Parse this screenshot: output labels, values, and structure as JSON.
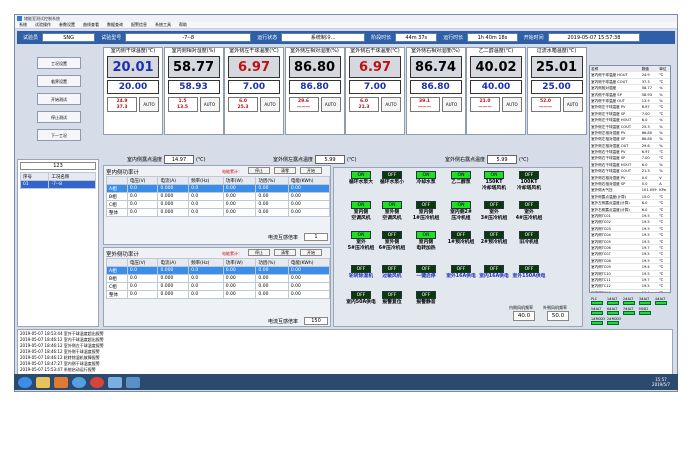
{
  "title": "储能室测试控制系统",
  "menu": [
    "系统",
    "试验操作",
    "参数设置",
    "曲线查看",
    "数据查询",
    "报警信息",
    "系统工具",
    "帮助"
  ],
  "info": [
    {
      "label": "试验员",
      "value": "SNG"
    },
    {
      "label": "试验型号",
      "value": "-7--8"
    },
    {
      "label": "运行状态",
      "value": "系统制冷..."
    },
    {
      "label": "阶段时长",
      "value": "44m 37s"
    },
    {
      "label": "运行时长",
      "value": "1h 40m 18s"
    },
    {
      "label": "开始时间",
      "value": "2019-05-07 15:57:38"
    }
  ],
  "left_buttons": [
    "工况设置",
    "临界设置",
    "开始测试",
    "停止测试",
    "下一工况"
  ],
  "tiles": [
    {
      "header": "室内侧干球温度(℃)",
      "pv": "20.01",
      "pv_color": "#1c2fb4",
      "sv": "20.00",
      "mv": "24.9\n37.3",
      "mode": "AUTO"
    },
    {
      "header": "室内侧相对湿度(%)",
      "pv": "58.77",
      "pv_color": "#000000",
      "sv": "58.93",
      "mv": "1.5\n13.5",
      "mode": "AUTO"
    },
    {
      "header": "室外侧左干球温度(℃)",
      "pv": "6.97",
      "pv_color": "#c01010",
      "sv": "7.00",
      "mv": "6.0\n25.3",
      "mode": "AUTO"
    },
    {
      "header": "室外侧左相对湿度(%)",
      "pv": "86.80",
      "pv_color": "#000000",
      "sv": "86.80",
      "mv": "29.6\n———",
      "mode": "AUTO"
    },
    {
      "header": "室外侧右干球温度(℃)",
      "pv": "6.97",
      "pv_color": "#c01010",
      "sv": "7.00",
      "mv": "6.0\n21.3",
      "mode": "AUTO"
    },
    {
      "header": "室外侧右相对湿度(%)",
      "pv": "86.74",
      "pv_color": "#000000",
      "sv": "86.80",
      "mv": "39.1\n———",
      "mode": "AUTO"
    },
    {
      "header": "乙二醇温度(℃)",
      "pv": "40.02",
      "pv_color": "#000000",
      "sv": "40.00",
      "mv": "21.0\n———",
      "mode": "AUTO"
    },
    {
      "header": "过流水箱温度(℃)",
      "pv": "25.01",
      "pv_color": "#000000",
      "sv": "25.00",
      "mv": "52.0\n———",
      "mode": "AUTO"
    }
  ],
  "dew": [
    {
      "label": "室内侧露点温度",
      "value": "14.97",
      "unit": "(℃)"
    },
    {
      "label": "室外侧左露点温度",
      "value": "5.99",
      "unit": "(℃)"
    },
    {
      "label": "室外侧右露点温度",
      "value": "5.99",
      "unit": "(℃)"
    }
  ],
  "left_list": {
    "value": "123",
    "headers": [
      "序号",
      "工况名称"
    ],
    "rows": [
      [
        "01",
        "-7--8"
      ]
    ]
  },
  "power": [
    {
      "title": "室内侧功率计",
      "hint": "电能累计：",
      "btns": [
        "停止",
        "清零",
        "开始"
      ],
      "headers": [
        "",
        "电压(V)",
        "电流(A)",
        "频率(Hz)",
        "功率(W)",
        "功因(%)",
        "电能(KWh)"
      ],
      "rows": [
        [
          "A相",
          "0.0",
          "0.000",
          "0.0",
          "0.00",
          "0.00",
          "0.00"
        ],
        [
          "B相",
          "0.0",
          "0.000",
          "0.0",
          "0.00",
          "0.00",
          "0.00"
        ],
        [
          "C相",
          "0.0",
          "0.000",
          "0.0",
          "0.00",
          "0.00",
          "0.00"
        ],
        [
          "整体",
          "0.0",
          "0.000",
          "0.0",
          "0.00",
          "0.00",
          "0.00"
        ]
      ],
      "ratio_label": "电流互感倍率",
      "ratio": "1"
    },
    {
      "title": "室外侧功率计",
      "hint": "电能累计：",
      "btns": [
        "停止",
        "清零",
        "开始"
      ],
      "headers": [
        "",
        "电压(V)",
        "电流(A)",
        "频率(Hz)",
        "功率(W)",
        "功因(%)",
        "电能(KWh)"
      ],
      "rows": [
        [
          "A相",
          "0.0",
          "0.000",
          "0.0",
          "0.00",
          "0.00",
          "0.00"
        ],
        [
          "B相",
          "0.0",
          "0.000",
          "0.0",
          "0.00",
          "0.00",
          "0.00"
        ],
        [
          "C相",
          "0.0",
          "0.000",
          "0.0",
          "0.00",
          "0.00",
          "0.00"
        ],
        [
          "整体",
          "0.0",
          "0.000",
          "0.0",
          "0.00",
          "0.00",
          "0.00"
        ]
      ],
      "ratio_label": "电流互感倍率",
      "ratio": "150"
    }
  ],
  "switches": [
    [
      {
        "s": "ON",
        "l": "循环水泵大"
      },
      {
        "s": "OFF",
        "l": "循环水泵小"
      },
      {
        "s": "ON",
        "l": "冷却水泵"
      },
      {
        "s": "ON",
        "l": "乙二醇泵"
      },
      {
        "s": "ON",
        "l": "150KT\n冷却塔风机"
      },
      {
        "s": "OFF",
        "l": "100KT\n冷却塔风机"
      }
    ],
    [
      {
        "s": "ON",
        "l": "室内侧\n空调风机"
      },
      {
        "s": "ON",
        "l": "室外侧\n空调风机"
      },
      {
        "s": "OFF",
        "l": "室内侧\n1#压冷机组"
      },
      {
        "s": "ON",
        "l": "室内侧2#\n压冷机组"
      },
      {
        "s": "OFF",
        "l": "室外\n3#压冷机组"
      },
      {
        "s": "OFF",
        "l": "室外\n4#压冷机组"
      }
    ],
    [
      {
        "s": "ON",
        "l": "室外\n5#压冷机组"
      },
      {
        "s": "OFF",
        "l": "室外侧\n6#压冷机组"
      },
      {
        "s": "ON",
        "l": "室内侧\n电转加热"
      },
      {
        "s": "OFF",
        "l": "1#预冷机组"
      },
      {
        "s": "OFF",
        "l": "2#预冷机组"
      },
      {
        "s": "OFF",
        "l": "旧冷机组"
      }
    ],
    [
      {
        "s": "OFF",
        "l": "轮转除湿机"
      },
      {
        "s": "OFF",
        "l": "过敏风机"
      },
      {
        "s": "OFF",
        "l": "一键启停"
      },
      {
        "s": "OFF",
        "l": "室外16A供电"
      },
      {
        "s": "OFF",
        "l": "室内16A供电"
      },
      {
        "s": "OFF",
        "l": "室外150A供电"
      }
    ],
    [
      {
        "s": "OFF",
        "l": "室内50A供电"
      },
      {
        "s": "OFF",
        "l": "报警复位"
      },
      {
        "s": "OFF",
        "l": "报警静音"
      }
    ]
  ],
  "outside": [
    {
      "label": "内侧风机频率",
      "value": "40.0"
    },
    {
      "label": "外侧风机频率",
      "value": "50.0"
    }
  ],
  "rlist": {
    "headers": [
      "名称",
      "数值",
      "单位"
    ],
    "rows": [
      [
        "室内侧干球温度 HOUT",
        "24.9",
        "℃"
      ],
      [
        "室内侧干球温度 COUT",
        "37.3",
        "℃"
      ],
      [
        "室内侧相对湿度",
        "58.77",
        "%"
      ],
      [
        "室内侧干球温度 SP",
        "58.93",
        "%"
      ],
      [
        "室内侧干球温度 OUT",
        "13.5",
        "%"
      ],
      [
        "室外侧左干球温度 PV",
        "6.97",
        "℃"
      ],
      [
        "室外侧左干球温度 SP",
        "7.00",
        "℃"
      ],
      [
        "室外侧左干球温度 HOUT",
        "6.0",
        "%"
      ],
      [
        "室外侧左干球温度 COUT",
        "25.3",
        "%"
      ],
      [
        "室外侧左相对湿度 PV",
        "86.80",
        "%"
      ],
      [
        "室外侧左相对湿度 SP",
        "86.80",
        "%"
      ],
      [
        "室外侧左相对湿度 OUT",
        "29.6",
        "%"
      ],
      [
        "室外侧右干球温度 PV",
        "6.97",
        "℃"
      ],
      [
        "室外侧右干球温度 SP",
        "7.00",
        "℃"
      ],
      [
        "室外侧右干球温度 HOUT",
        "6.0",
        "%"
      ],
      [
        "室外侧右干球温度 COUT",
        "21.3",
        "%"
      ],
      [
        "室外侧右相对湿度 PV",
        "0.0",
        "V"
      ],
      [
        "室外侧右相对湿度 SP",
        "0.0",
        "A"
      ],
      [
        "室外侧大气压",
        "101.059",
        "KPa"
      ],
      [
        "室外侧露点温度(计算)",
        "15.0",
        "℃"
      ],
      [
        "室外左侧露点温度(计算)",
        "6.0",
        "℃"
      ],
      [
        "室外右侧露点温度(计算)",
        "6.0",
        "℃"
      ],
      [
        "室内侧TC01",
        "19.5",
        "℃"
      ],
      [
        "室内侧TC02",
        "19.5",
        "℃"
      ],
      [
        "室内侧TC03",
        "19.5",
        "℃"
      ],
      [
        "室内侧TC04",
        "19.5",
        "℃"
      ],
      [
        "室内侧TC05",
        "19.5",
        "℃"
      ],
      [
        "室内侧TC06",
        "19.7",
        "℃"
      ],
      [
        "室内侧TC07",
        "19.5",
        "℃"
      ],
      [
        "室内侧TC08",
        "19.5",
        "℃"
      ],
      [
        "室内侧TC09",
        "19.4",
        "℃"
      ],
      [
        "室内侧TC10",
        "19.5",
        "℃"
      ],
      [
        "室内侧TC11",
        "19.7",
        "℃"
      ],
      [
        "室内侧TC12",
        "19.5",
        "℃"
      ],
      [
        "室内侧TC13",
        "19.4",
        "℃"
      ]
    ]
  },
  "mini": [
    "PLC",
    "1#ALT",
    "2#ALT",
    "3#ALT",
    "4#ALT",
    "5#ALT",
    "6#ALT",
    "7#ALT",
    "M0D2",
    "1#M0D3",
    "2#M0D3"
  ],
  "log": [
    "2019-05-07 18:53:44  室外干球温度超出报警",
    "2019-05-07 18:46:12  室内干球温度超出报警",
    "2019-05-07 18:46:12  室外侧左干球温度报警",
    "2019-05-07 18:46:12  室外侧干球温度报警",
    "2019-05-07 18:46:12  轮转除湿机故障报警",
    "2019-05-07 18:47:27  室内侧干球温度报警",
    "2019-05-07 15:53:47  系统启动运行报警"
  ],
  "taskbar": {
    "time": "15:57",
    "date": "2019/5/7"
  }
}
